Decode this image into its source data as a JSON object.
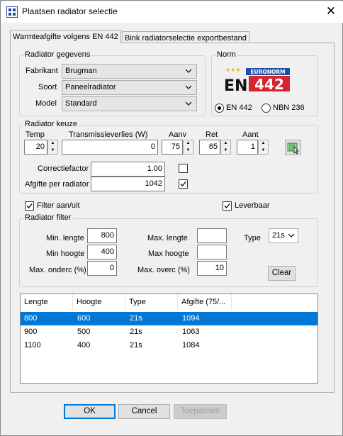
{
  "window": {
    "title": "Plaatsen radiator selectie"
  },
  "tabs": [
    {
      "label": "Warmteafgifte volgens EN 442"
    },
    {
      "label": "Bink radiatorselectie exportbestand"
    }
  ],
  "radiator_gegevens": {
    "title": "Radiator gegevens",
    "fabrikant_label": "Fabrikant",
    "fabrikant_value": "Brugman",
    "soort_label": "Soort",
    "soort_value": "Paneelradiator",
    "model_label": "Model",
    "model_value": "Standard"
  },
  "norm": {
    "title": "Norm",
    "logo_text_en": "EN",
    "logo_text_num": "442",
    "logo_text_euronorm": "EURONORM",
    "options": [
      {
        "label": "EN 442",
        "selected": true
      },
      {
        "label": "NBN 236",
        "selected": false
      }
    ]
  },
  "radiator_keuze": {
    "title": "Radiator keuze",
    "temp_label": "Temp",
    "temp_value": "20",
    "trans_label": "Transmissieverlies (W)",
    "trans_value": "0",
    "aanv_label": "Aanv",
    "aanv_value": "75",
    "ret_label": "Ret",
    "ret_value": "65",
    "aant_label": "Aant",
    "aant_value": "1",
    "correctie_label": "Correctiefactor",
    "correctie_value": "1.00",
    "correctie_checked": false,
    "afgifte_label": "Afgifte per radiator",
    "afgifte_value": "1042",
    "afgifte_checked": true
  },
  "filter_toggle": {
    "label": "Filter aan/uit",
    "checked": true
  },
  "leverbaar": {
    "label": "Leverbaar",
    "checked": true
  },
  "radiator_filter": {
    "title": "Radiator filter",
    "min_lengte_label": "Min. lengte",
    "min_lengte_value": "800",
    "min_hoogte_label": "Min hoogte",
    "min_hoogte_value": "400",
    "max_onderc_label": "Max. onderc (%)",
    "max_onderc_value": "0",
    "max_lengte_label": "Max. lengte",
    "max_lengte_value": "",
    "max_hoogte_label": "Max hoogte",
    "max_hoogte_value": "",
    "max_overc_label": "Max. overc (%)",
    "max_overc_value": "10",
    "type_label": "Type",
    "type_value": "21s",
    "clear_label": "Clear"
  },
  "results": {
    "columns": [
      "Lengte",
      "Hoogte",
      "Type",
      "Afgifte (75/..."
    ],
    "rows": [
      {
        "lengte": "800",
        "hoogte": "600",
        "type": "21s",
        "afgifte": "1094",
        "selected": true
      },
      {
        "lengte": "900",
        "hoogte": "500",
        "type": "21s",
        "afgifte": "1063",
        "selected": false
      },
      {
        "lengte": "1100",
        "hoogte": "400",
        "type": "21s",
        "afgifte": "1084",
        "selected": false
      }
    ]
  },
  "footer": {
    "ok_label": "OK",
    "cancel_label": "Cancel",
    "apply_label": "Toepassen"
  },
  "colors": {
    "selection": "#0078d7",
    "logo_blue": "#1f4fa3",
    "logo_red": "#d9232d"
  },
  "icons": [
    "app-icon",
    "close-icon",
    "chevron-down-icon",
    "spin-up-icon",
    "spin-down-icon",
    "select-radiator-icon",
    "check-icon"
  ]
}
